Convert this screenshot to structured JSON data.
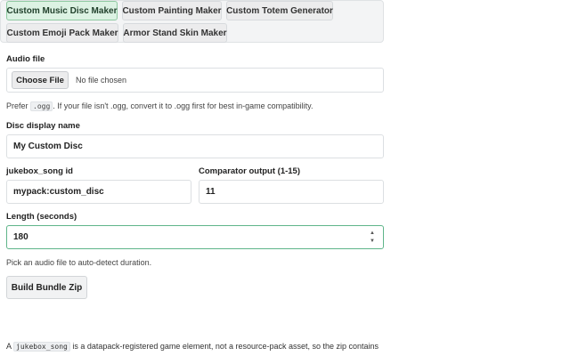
{
  "tabs": [
    {
      "label": "Custom Music Disc Maker",
      "active": true
    },
    {
      "label": "Custom Painting Maker",
      "active": false
    },
    {
      "label": "Custom Totem Generator",
      "active": false
    },
    {
      "label": "Custom Emoji Pack Maker",
      "active": false
    },
    {
      "label": "Armor Stand Skin Maker",
      "active": false
    }
  ],
  "audio": {
    "label": "Audio file",
    "choose_label": "Choose File",
    "no_file": "No file chosen",
    "hint_prefix": "Prefer",
    "hint_code": ".ogg",
    "hint_suffix": ". If your file isn't .ogg, convert it to .ogg first for best in-game compatibility."
  },
  "disc_name": {
    "label": "Disc display name",
    "value": "My Custom Disc"
  },
  "jukebox_id": {
    "label": "jukebox_song id",
    "value": "mypack:custom_disc"
  },
  "comparator": {
    "label": "Comparator output (1-15)",
    "value": "11"
  },
  "length": {
    "label": "Length (seconds)",
    "value": "180",
    "hint": "Pick an audio file to auto-detect duration."
  },
  "build_label": "Build Bundle Zip",
  "footer": {
    "prefix": "A",
    "code": "jukebox_song",
    "suffix": "is a datapack-registered game element, not a resource-pack asset, so the zip contains"
  }
}
